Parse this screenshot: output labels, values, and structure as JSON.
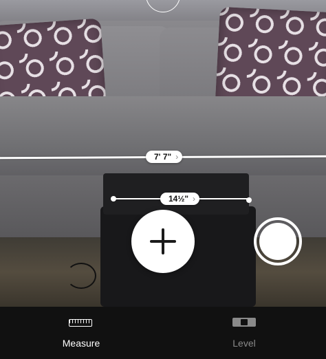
{
  "measurements": {
    "long": {
      "label": "7' 7\""
    },
    "short": {
      "label": "14½\""
    }
  },
  "controls": {
    "add_point": "plus-icon",
    "capture": "shutter-icon",
    "reticle": "reticle-icon"
  },
  "tabs": [
    {
      "label": "Measure",
      "icon": "ruler-icon",
      "selected": true
    },
    {
      "label": "Level",
      "icon": "level-icon",
      "selected": false
    }
  ],
  "colors": {
    "tab_active": "#ffffff",
    "tab_inactive": "#8a8a8a",
    "tabbar_bg": "#111111"
  }
}
